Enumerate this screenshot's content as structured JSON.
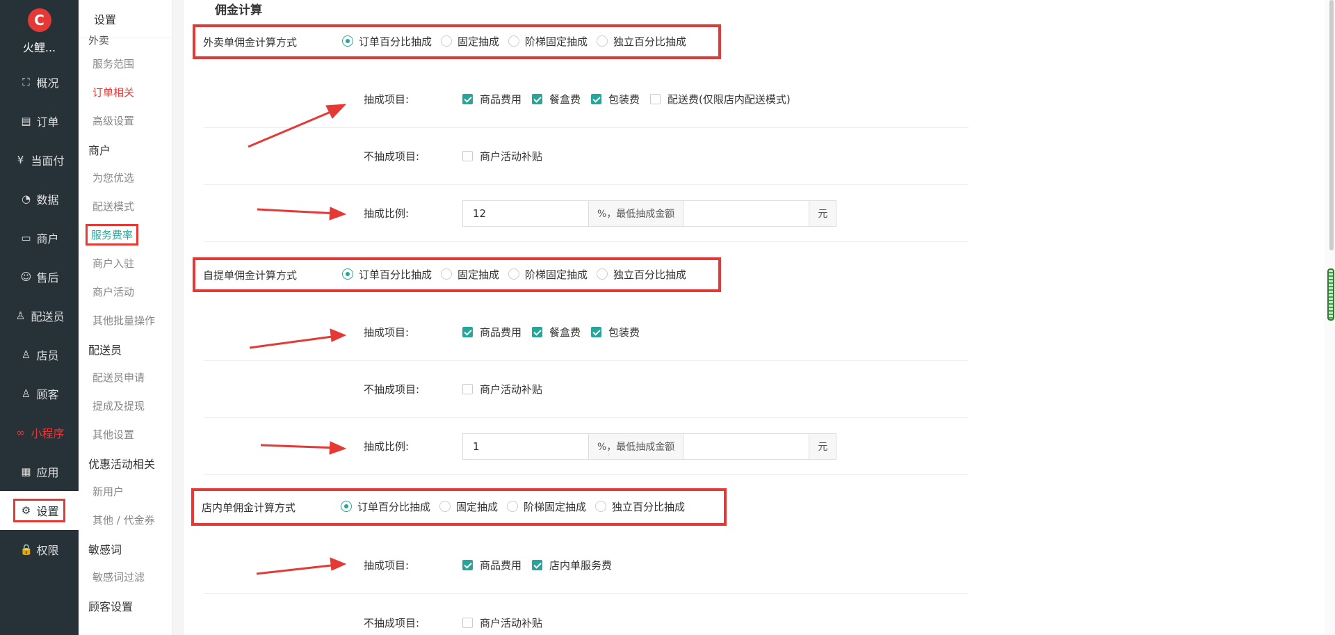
{
  "app": {
    "brand_name": "火鲤...",
    "logo_glyph": "C"
  },
  "nav": [
    {
      "id": "overview",
      "label": "概况",
      "icon": "⛶"
    },
    {
      "id": "orders",
      "label": "订单",
      "icon": "▤"
    },
    {
      "id": "facepay",
      "label": "当面付",
      "icon": "¥"
    },
    {
      "id": "data",
      "label": "数据",
      "icon": "◔"
    },
    {
      "id": "merchant",
      "label": "商户",
      "icon": "▭"
    },
    {
      "id": "aftersale",
      "label": "售后",
      "icon": "☺"
    },
    {
      "id": "courier",
      "label": "配送员",
      "icon": "♙"
    },
    {
      "id": "clerk",
      "label": "店员",
      "icon": "♙"
    },
    {
      "id": "customer",
      "label": "顾客",
      "icon": "♙"
    },
    {
      "id": "miniapp",
      "label": "小程序",
      "icon": "∞"
    },
    {
      "id": "apps",
      "label": "应用",
      "icon": "▦"
    },
    {
      "id": "settings",
      "label": "设置",
      "icon": "⚙"
    },
    {
      "id": "permission",
      "label": "权限",
      "icon": "🔒"
    }
  ],
  "subnav": {
    "title": "设置",
    "cut_label": "外卖",
    "items": [
      {
        "type": "item",
        "label": "服务范围"
      },
      {
        "type": "item",
        "label": "订单相关"
      },
      {
        "type": "item",
        "label": "高级设置"
      },
      {
        "type": "group",
        "label": "商户"
      },
      {
        "type": "item",
        "label": "为您优选"
      },
      {
        "type": "item",
        "label": "配送模式"
      },
      {
        "type": "item",
        "label": "服务费率"
      },
      {
        "type": "item",
        "label": "商户入驻"
      },
      {
        "type": "item",
        "label": "商户活动"
      },
      {
        "type": "item",
        "label": "其他批量操作"
      },
      {
        "type": "group",
        "label": "配送员"
      },
      {
        "type": "item",
        "label": "配送员申请"
      },
      {
        "type": "item",
        "label": "提成及提现"
      },
      {
        "type": "item",
        "label": "其他设置"
      },
      {
        "type": "group",
        "label": "优惠活动相关"
      },
      {
        "type": "item",
        "label": "新用户"
      },
      {
        "type": "item",
        "label": "其他 / 代金券"
      },
      {
        "type": "group",
        "label": "敏感词"
      },
      {
        "type": "item",
        "label": "敏感词过滤"
      },
      {
        "type": "group",
        "label": "顾客设置"
      }
    ]
  },
  "main": {
    "section_title": "佣金计算",
    "radio_options": [
      "订单百分比抽成",
      "固定抽成",
      "阶梯固定抽成",
      "独立百分比抽成"
    ],
    "labels": {
      "include": "抽成项目:",
      "exclude": "不抽成项目:",
      "ratio": "抽成比例:",
      "addon": "%，最低抽成金额",
      "unit": "元"
    },
    "takeout": {
      "method_label": "外卖单佣金计算方式",
      "include_items": [
        {
          "label": "商品费用",
          "checked": true
        },
        {
          "label": "餐盒费",
          "checked": true
        },
        {
          "label": "包装费",
          "checked": true
        },
        {
          "label": "配送费(仅限店内配送模式)",
          "checked": false
        }
      ],
      "exclude_items": [
        {
          "label": "商户活动补贴",
          "checked": false
        }
      ],
      "ratio_value": "12"
    },
    "pickup": {
      "method_label": "自提单佣金计算方式",
      "include_items": [
        {
          "label": "商品费用",
          "checked": true
        },
        {
          "label": "餐盒费",
          "checked": true
        },
        {
          "label": "包装费",
          "checked": true
        }
      ],
      "exclude_items": [
        {
          "label": "商户活动补贴",
          "checked": false
        }
      ],
      "ratio_value": "1"
    },
    "dinein": {
      "method_label": "店内单佣金计算方式",
      "include_items": [
        {
          "label": "商品费用",
          "checked": true
        },
        {
          "label": "店内单服务费",
          "checked": true
        }
      ],
      "exclude_items": [
        {
          "label": "商户活动补贴",
          "checked": false
        }
      ]
    }
  },
  "colors": {
    "accent": "#26a69a",
    "highlight": "#e53935",
    "sidebar": "#263238"
  }
}
